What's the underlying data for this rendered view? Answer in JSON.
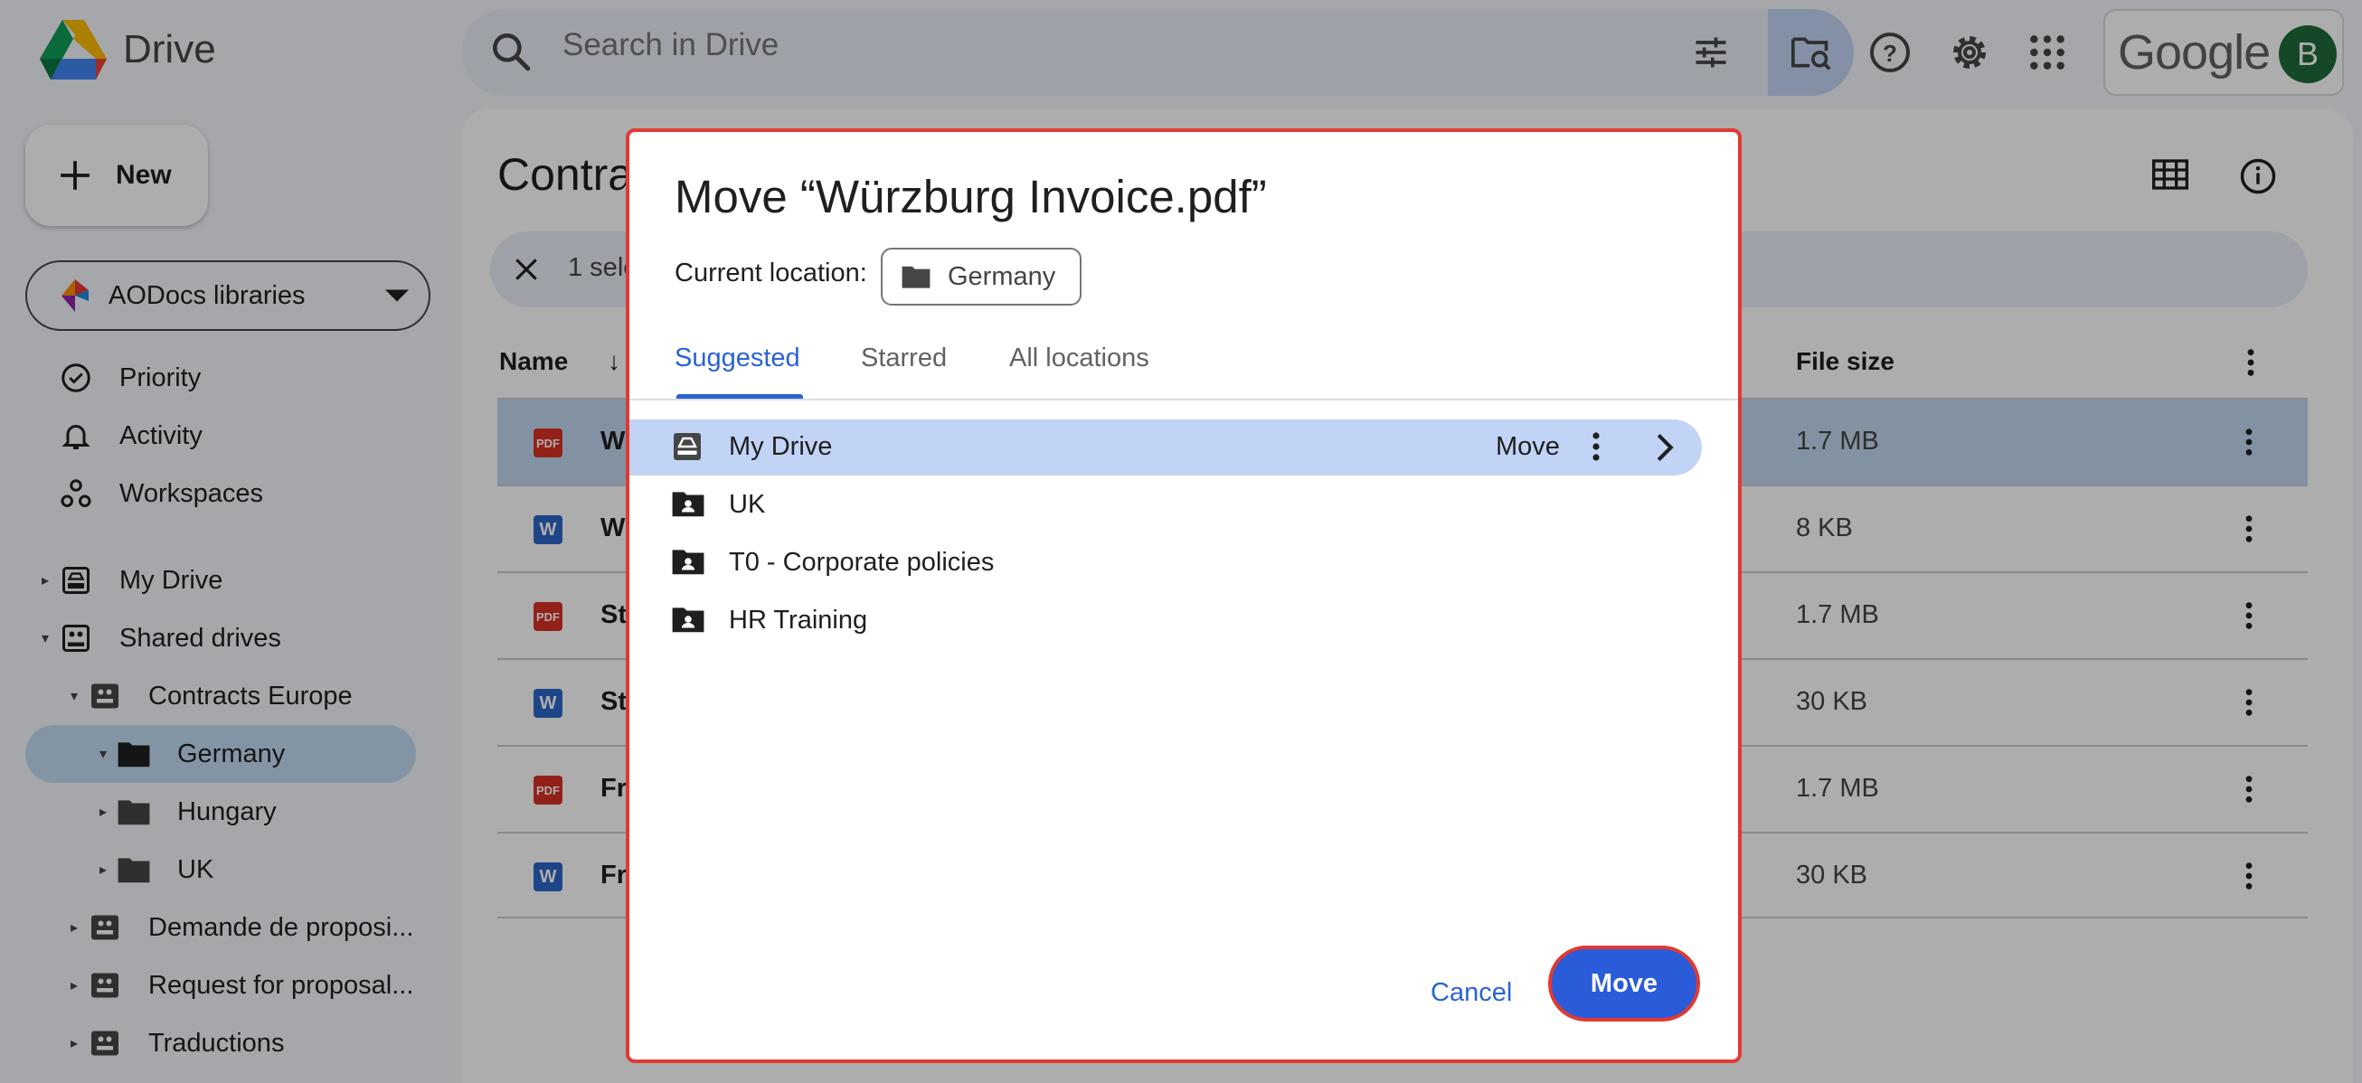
{
  "app": {
    "name": "Drive"
  },
  "search": {
    "placeholder": "Search in Drive"
  },
  "account": {
    "brand": "Google",
    "avatar_letter": "B"
  },
  "sidebar": {
    "new_label": "New",
    "library_selector": "AODocs libraries",
    "items": [
      {
        "label": "Priority",
        "icon": "priority-icon"
      },
      {
        "label": "Activity",
        "icon": "bell-icon"
      },
      {
        "label": "Workspaces",
        "icon": "workspaces-icon"
      },
      {
        "label": "My Drive",
        "icon": "my-drive-icon"
      },
      {
        "label": "Shared drives",
        "icon": "shared-drives-icon"
      },
      {
        "label": "Contracts Europe",
        "icon": "shared-drive-icon"
      },
      {
        "label": "Germany",
        "icon": "folder-icon",
        "selected": true
      },
      {
        "label": "Hungary",
        "icon": "folder-icon"
      },
      {
        "label": "UK",
        "icon": "folder-icon"
      },
      {
        "label": "Demande de proposi...",
        "icon": "shared-drive-icon"
      },
      {
        "label": "Request for proposal...",
        "icon": "shared-drive-icon"
      },
      {
        "label": "Traductions",
        "icon": "shared-drive-icon"
      }
    ]
  },
  "main": {
    "title": "Contra",
    "selection_text": "1 sele",
    "columns": {
      "name": "Name",
      "sort_arrow": "↓",
      "size": "File size"
    },
    "files": [
      {
        "name": "W",
        "type": "pdf",
        "size": "1.7 MB",
        "selected": true
      },
      {
        "name": "W",
        "type": "word",
        "size": "8 KB"
      },
      {
        "name": "St",
        "type": "pdf",
        "size": "1.7 MB"
      },
      {
        "name": "St",
        "type": "word",
        "size": "30 KB"
      },
      {
        "name": "Fr",
        "type": "pdf",
        "size": "1.7 MB"
      },
      {
        "name": "Fr",
        "type": "word",
        "size": "30 KB"
      }
    ],
    "file_badges": {
      "pdf": "PDF",
      "word": "W"
    }
  },
  "dialog": {
    "title": "Move “Würzburg Invoice.pdf”",
    "current_location_label": "Current location:",
    "current_location": "Germany",
    "tabs": [
      "Suggested",
      "Starred",
      "All locations"
    ],
    "active_tab": "Suggested",
    "locations": [
      {
        "name": "My Drive",
        "icon": "my-drive-icon",
        "highlighted": true
      },
      {
        "name": "UK",
        "icon": "shared-folder-icon"
      },
      {
        "name": "T0 - Corporate policies",
        "icon": "shared-folder-icon"
      },
      {
        "name": "HR Training",
        "icon": "shared-folder-icon"
      }
    ],
    "row_move_label": "Move",
    "cancel_label": "Cancel",
    "move_label": "Move"
  },
  "colors": {
    "accent": "#2a63d4",
    "highlight": "#e03a32",
    "selected_row": "#c2d7ef"
  }
}
